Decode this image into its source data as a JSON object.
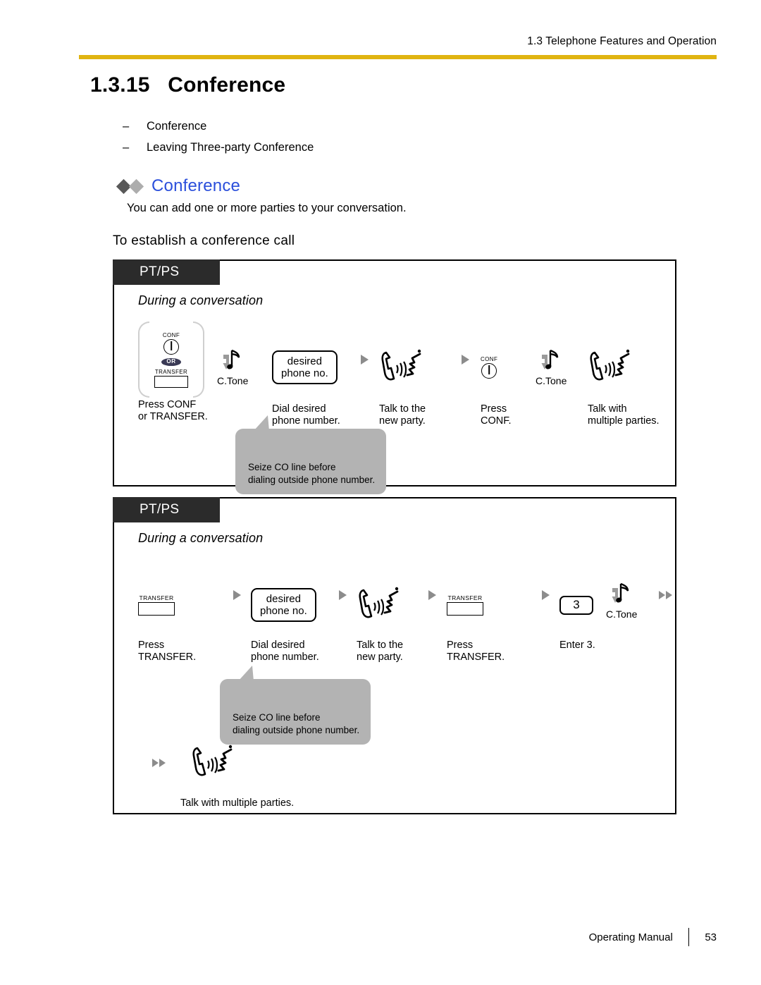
{
  "header": {
    "running_head": "1.3 Telephone Features and Operation",
    "rule_color": "#E0B411"
  },
  "section": {
    "number": "1.3.15",
    "title": "Conference",
    "heading_line": "1.3.15   Conference"
  },
  "toc_items": [
    {
      "dash": "–",
      "label": "Conference"
    },
    {
      "dash": "–",
      "label": "Leaving Three-party Conference"
    }
  ],
  "feature": {
    "title": "Conference",
    "title_color": "#2B4FDB",
    "description": "You can add one or more parties to your conversation.",
    "diamond_dark": "#595959",
    "diamond_light": "#ADADAD"
  },
  "procedure_heading": "To establish a conference call",
  "panels": [
    {
      "tab_label": "PT/PS",
      "subtitle": "During a conversation",
      "steps": [
        {
          "glyph": "conf-or-transfer-keygroup",
          "conf_label": "CONF",
          "or_label": "OR",
          "transfer_label": "TRANSFER",
          "caption": "Press CONF\nor TRANSFER."
        },
        {
          "glyph": "confirmation-tone",
          "tone_label": "C.Tone",
          "caption": ""
        },
        {
          "glyph": "value-box",
          "value": "desired\nphone no.",
          "caption": "Dial desired\nphone number."
        },
        {
          "glyph": "talking-phone",
          "caption": "Talk to the\nnew party."
        },
        {
          "glyph": "conf-key",
          "conf_label": "CONF",
          "caption": "Press CONF."
        },
        {
          "glyph": "confirmation-tone",
          "tone_label": "C.Tone",
          "caption": ""
        },
        {
          "glyph": "talking-phone",
          "caption": "Talk with\nmultiple parties."
        }
      ],
      "callout": "Seize CO line before\ndialing outside phone number."
    },
    {
      "tab_label": "PT/PS",
      "subtitle": "During a conversation",
      "steps": [
        {
          "glyph": "transfer-key",
          "transfer_label": "TRANSFER",
          "caption": "Press TRANSFER."
        },
        {
          "glyph": "value-box",
          "value": "desired\nphone no.",
          "caption": "Dial desired\nphone number."
        },
        {
          "glyph": "talking-phone",
          "caption": "Talk to the\nnew party."
        },
        {
          "glyph": "transfer-key",
          "transfer_label": "TRANSFER",
          "caption": "Press TRANSFER."
        },
        {
          "glyph": "key-box",
          "value": "3",
          "tone_label": "C.Tone",
          "caption": "Enter 3."
        }
      ],
      "final_step": {
        "glyph": "talking-phone",
        "caption": "Talk with multiple parties."
      },
      "callout": "Seize CO line before\ndialing outside phone number."
    }
  ],
  "footer": {
    "manual_name": "Operating Manual",
    "page_number": "53"
  }
}
